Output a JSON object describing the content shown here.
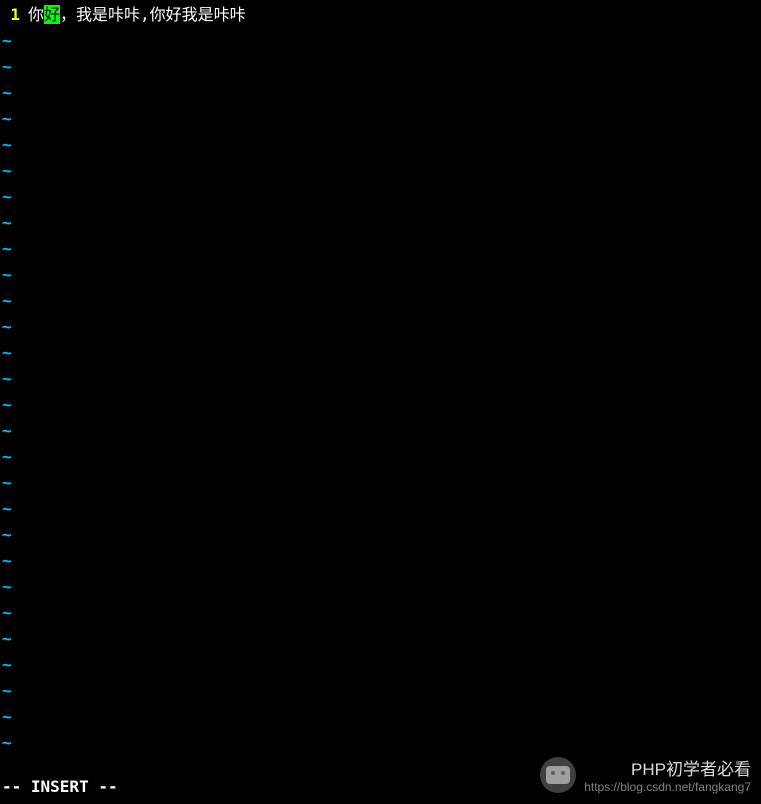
{
  "editor": {
    "line_number": "1",
    "text_before_cursor": "你",
    "cursor_char": "好",
    "text_after_cursor": "，我是咔咔,你好我是咔咔",
    "tilde": "~",
    "empty_line_count": 28
  },
  "status": {
    "mode": "-- INSERT --"
  },
  "watermark": {
    "title": "PHP初学者必看",
    "url": "https://blog.csdn.net/fangkang7"
  }
}
